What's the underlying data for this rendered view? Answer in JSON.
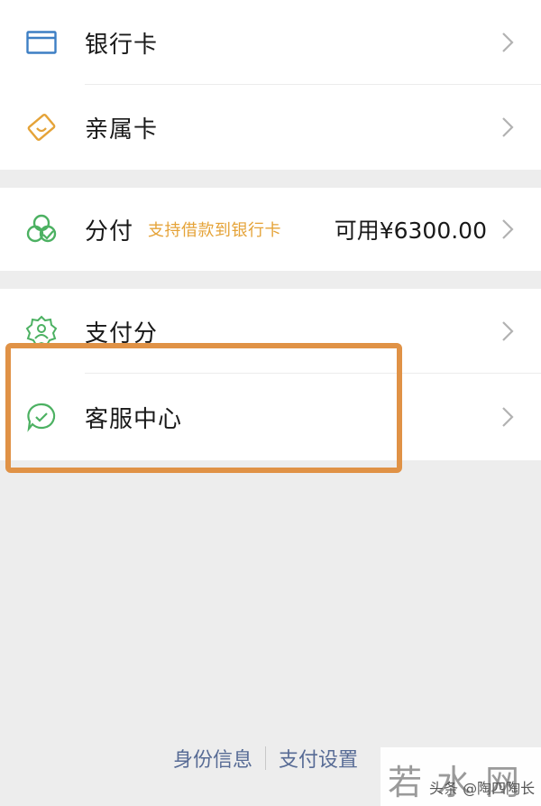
{
  "menu_groups": [
    {
      "items": [
        {
          "label": "银行卡",
          "icon": "bank-card-icon",
          "icon_color": "#3d7fc4"
        },
        {
          "label": "亲属卡",
          "icon": "family-card-icon",
          "icon_color": "#e5a338"
        }
      ]
    },
    {
      "items": [
        {
          "label": "分付",
          "promo": "支持借款到银行卡",
          "available": "可用¥6300.00",
          "icon": "fenfu-icon",
          "icon_color": "#4cb162"
        }
      ]
    },
    {
      "items": [
        {
          "label": "支付分",
          "icon": "pay-score-icon",
          "icon_color": "#4cb162"
        },
        {
          "label": "客服中心",
          "icon": "customer-service-icon",
          "icon_color": "#4cb162"
        }
      ]
    }
  ],
  "footer": {
    "identity_link": "身份信息",
    "settings_link": "支付设置"
  },
  "watermark": {
    "brand": "若水网",
    "caption": "头条 @陶四陶长"
  },
  "colors": {
    "highlight": "#e09246",
    "link": "#576b95",
    "promo": "#e5a338",
    "background": "#ededed"
  }
}
